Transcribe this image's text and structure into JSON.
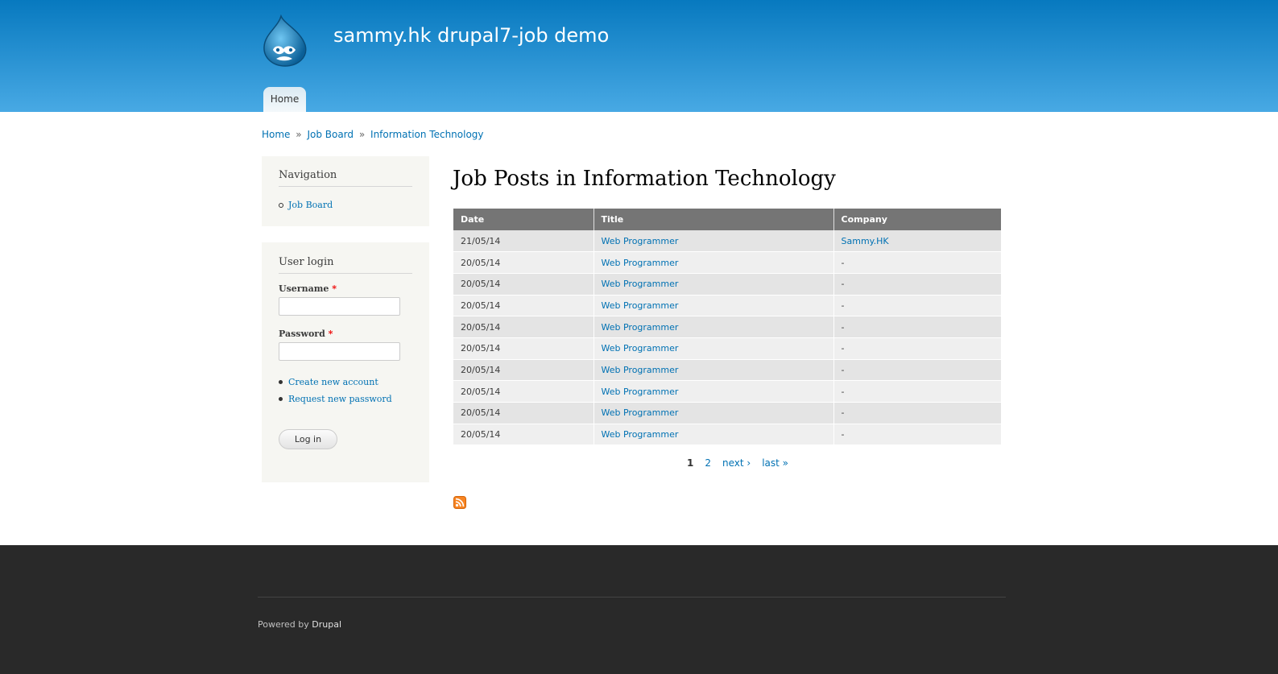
{
  "site": {
    "name": "sammy.hk drupal7-job demo"
  },
  "main_menu": {
    "home_label": "Home"
  },
  "breadcrumb": {
    "items": [
      "Home",
      "Job Board",
      "Information Technology"
    ],
    "separator": "»"
  },
  "navigation_block": {
    "title": "Navigation",
    "items": [
      "Job Board"
    ]
  },
  "login_block": {
    "title": "User login",
    "username_label": "Username",
    "password_label": "Password",
    "required_mark": "*",
    "links": [
      "Create new account",
      "Request new password"
    ],
    "button_label": "Log in"
  },
  "page": {
    "title": "Job Posts in Information Technology"
  },
  "table": {
    "headers": [
      "Date",
      "Title",
      "Company"
    ],
    "rows": [
      [
        "21/05/14",
        "Web Programmer",
        "Sammy.HK"
      ],
      [
        "20/05/14",
        "Web Programmer",
        "-"
      ],
      [
        "20/05/14",
        "Web Programmer",
        "-"
      ],
      [
        "20/05/14",
        "Web Programmer",
        "-"
      ],
      [
        "20/05/14",
        "Web Programmer",
        "-"
      ],
      [
        "20/05/14",
        "Web Programmer",
        "-"
      ],
      [
        "20/05/14",
        "Web Programmer",
        "-"
      ],
      [
        "20/05/14",
        "Web Programmer",
        "-"
      ],
      [
        "20/05/14",
        "Web Programmer",
        "-"
      ],
      [
        "20/05/14",
        "Web Programmer",
        "-"
      ]
    ]
  },
  "pager": {
    "current": "1",
    "page2": "2",
    "next": "next ›",
    "last": "last »"
  },
  "footer": {
    "powered_prefix": "Powered by",
    "powered_link": "Drupal"
  },
  "colors": {
    "header_top": "#0779bf",
    "header_bottom": "#48a9e4",
    "link": "#0071b3",
    "footer_bg": "#292929",
    "table_header": "#757575"
  },
  "icons": {
    "logo": "drupal-drop-logo-icon",
    "feed": "rss-feed-icon"
  }
}
